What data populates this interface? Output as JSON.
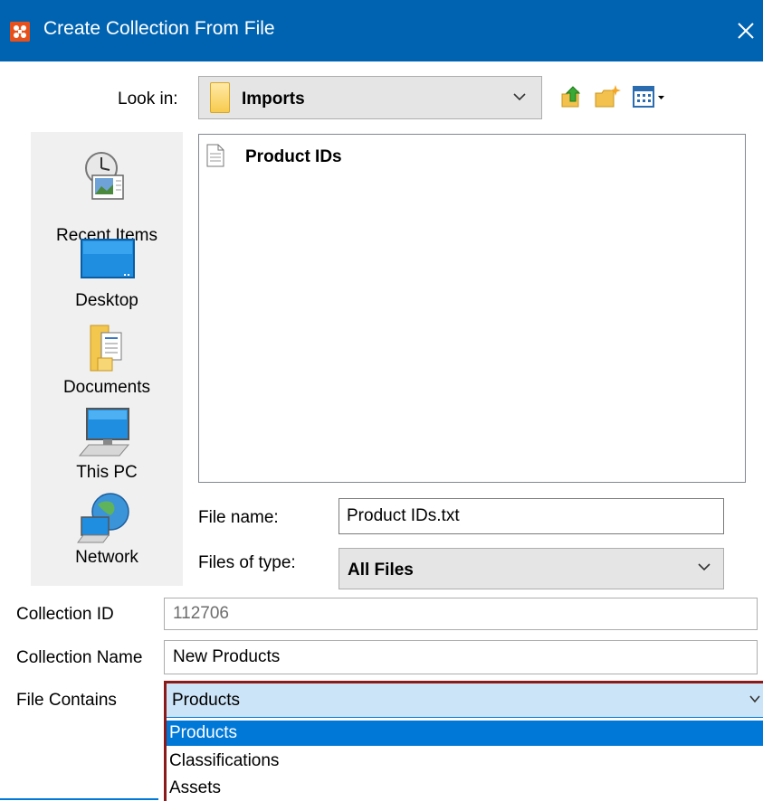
{
  "window": {
    "title": "Create Collection From File",
    "title_bar_color": "#0063b1",
    "icons": {
      "app": "app-logo-icon",
      "close": "close-icon"
    }
  },
  "look_in": {
    "label": "Look in:",
    "value": "Imports",
    "icons": [
      "folder-icon",
      "chevron-down-icon",
      "up-folder-icon",
      "new-folder-icon",
      "view-menu-icon"
    ]
  },
  "places": [
    {
      "label": "Recent Items",
      "icon": "recent-items-icon"
    },
    {
      "label": "Desktop",
      "icon": "desktop-icon"
    },
    {
      "label": "Documents",
      "icon": "documents-icon"
    },
    {
      "label": "This PC",
      "icon": "this-pc-icon"
    },
    {
      "label": "Network",
      "icon": "network-icon"
    }
  ],
  "file_list": [
    {
      "name": "Product IDs",
      "icon": "text-file-icon"
    }
  ],
  "file_name": {
    "label": "File name:",
    "value": "Product IDs.txt"
  },
  "files_of_type": {
    "label": "Files of type:",
    "value": "All Files"
  },
  "collection_id": {
    "label": "Collection ID",
    "value": "112706"
  },
  "collection_name": {
    "label": "Collection Name",
    "value": "New Products"
  },
  "file_contains": {
    "label": "File Contains",
    "value": "Products",
    "options": [
      "Products",
      "Classifications",
      "Assets"
    ],
    "selected_index": 0,
    "highlight_color": "#8b1a1a",
    "selection_color": "#0078d7"
  }
}
